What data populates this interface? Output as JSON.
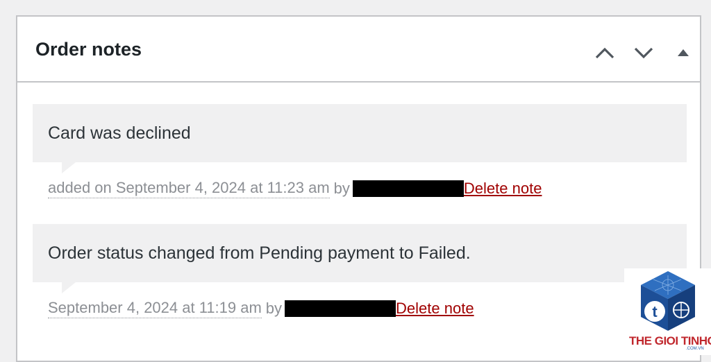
{
  "panel": {
    "title": "Order notes",
    "controls": {
      "move_up": "chevron-up-icon",
      "move_down": "chevron-down-icon",
      "toggle": "triangle-up-icon"
    }
  },
  "notes": [
    {
      "content": "Card was declined",
      "meta_date": "added on September 4, 2024 at 11:23 am",
      "meta_by": "by",
      "author_redacted": true,
      "delete_label": "Delete note"
    },
    {
      "content": "Order status changed from Pending payment to Failed.",
      "meta_date": "September 4, 2024 at 11:19 am",
      "meta_by": "by",
      "author_redacted": true,
      "delete_label": "Delete note"
    }
  ],
  "watermark": {
    "brand": "THE GIOI TINHOC",
    "domain": ".COM.VN"
  },
  "colors": {
    "background": "#f0f0f1",
    "panel_border": "#c3c4c7",
    "bubble": "#f0f0f1",
    "meta_text": "#8c8f94",
    "delete_link": "#a00000",
    "watermark_red": "#c0272d",
    "watermark_blue": "#1e5aa8"
  }
}
